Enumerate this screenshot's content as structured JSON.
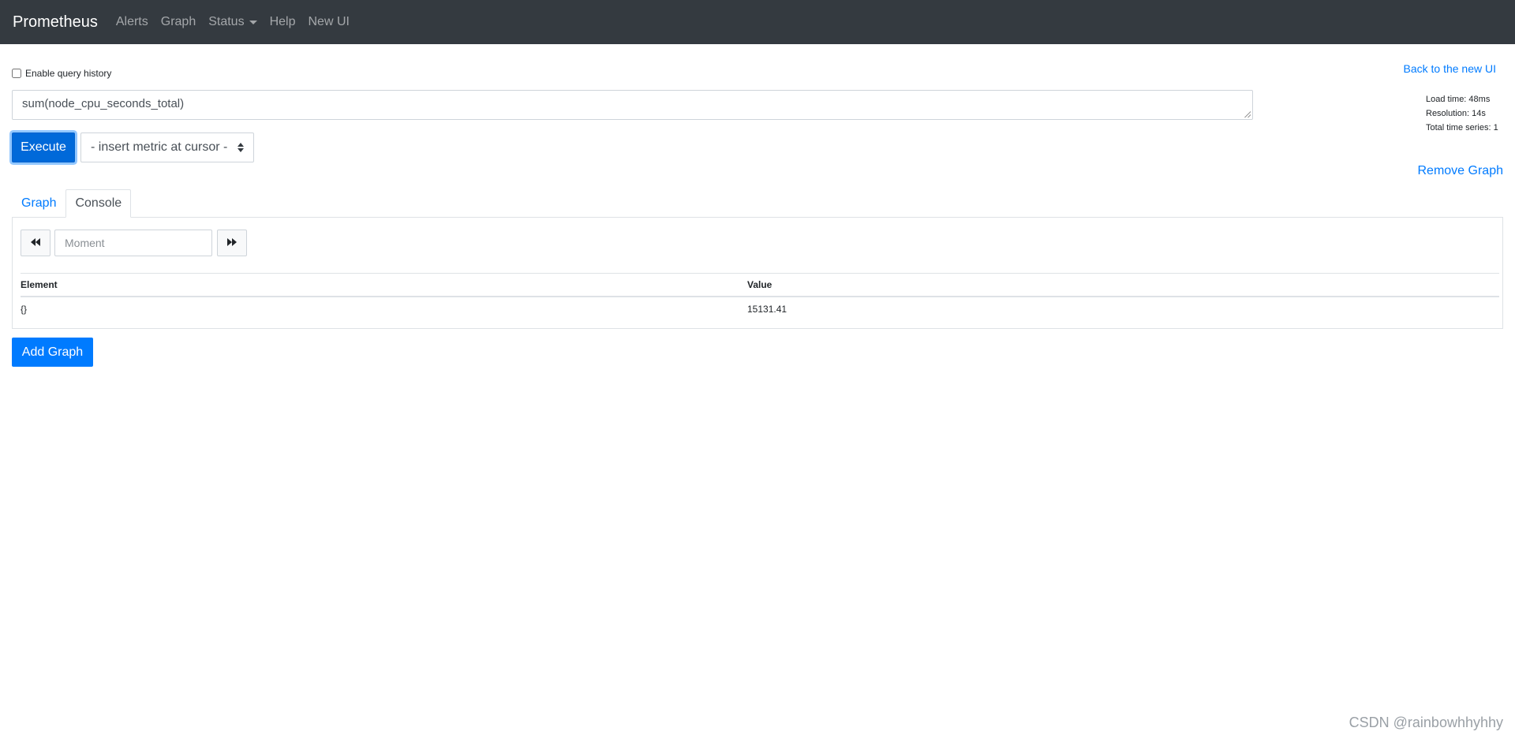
{
  "navbar": {
    "brand": "Prometheus",
    "links": [
      "Alerts",
      "Graph",
      "Status",
      "Help",
      "New UI"
    ]
  },
  "query": {
    "history_label": "Enable query history",
    "history_checked": false,
    "back_link": "Back to the new UI",
    "expression": "sum(node_cpu_seconds_total)",
    "execute_label": "Execute",
    "metric_select": "- insert metric at cursor -",
    "stats": {
      "load_time": "Load time: 48ms",
      "resolution": "Resolution: 14s",
      "total_series": "Total time series: 1"
    },
    "remove_graph": "Remove Graph"
  },
  "tabs": [
    {
      "label": "Graph",
      "active": false
    },
    {
      "label": "Console",
      "active": true
    }
  ],
  "console": {
    "moment_placeholder": "Moment",
    "headers": {
      "element": "Element",
      "value": "Value"
    },
    "rows": [
      {
        "element": "{}",
        "value": "15131.41"
      }
    ]
  },
  "add_graph": "Add Graph",
  "watermark": "CSDN @rainbowhhyhhy"
}
